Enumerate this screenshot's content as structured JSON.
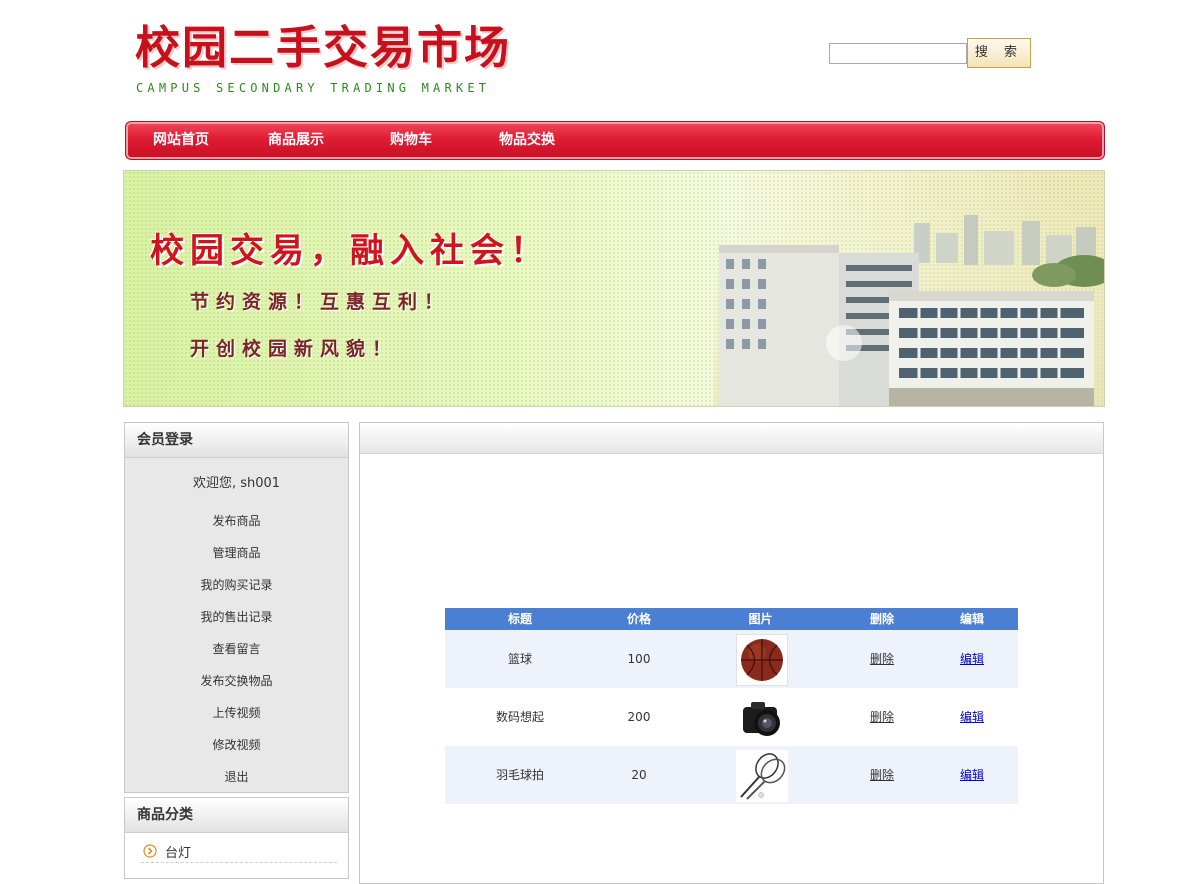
{
  "header": {
    "logo_title": "校园二手交易市场",
    "logo_subtitle": "CAMPUS SECONDARY TRADING MARKET",
    "search_placeholder": "",
    "search_button": "搜 索"
  },
  "nav": {
    "items": [
      {
        "label": "网站首页"
      },
      {
        "label": "商品展示"
      },
      {
        "label": "购物车"
      },
      {
        "label": "物品交换"
      }
    ]
  },
  "banner": {
    "headline": "校园交易，融入社会！",
    "line1": "节约资源！互惠互利！",
    "line2": "开创校园新风貌！"
  },
  "sidebar": {
    "login_title": "会员登录",
    "welcome": "欢迎您, sh001",
    "menu": [
      {
        "label": "发布商品"
      },
      {
        "label": "管理商品"
      },
      {
        "label": "我的购买记录"
      },
      {
        "label": "我的售出记录"
      },
      {
        "label": "查看留言"
      },
      {
        "label": "发布交换物品"
      },
      {
        "label": "上传视频"
      },
      {
        "label": "修改视频"
      },
      {
        "label": "退出"
      }
    ],
    "category_title": "商品分类",
    "categories": [
      {
        "label": "台灯"
      }
    ]
  },
  "table": {
    "headers": [
      "标题",
      "价格",
      "图片",
      "删除",
      "编辑"
    ],
    "rows": [
      {
        "title": "篮球",
        "price": "100",
        "image": "basketball",
        "delete": "删除",
        "edit": "编辑"
      },
      {
        "title": "数码想起",
        "price": "200",
        "image": "camera",
        "delete": "删除",
        "edit": "编辑"
      },
      {
        "title": "羽毛球拍",
        "price": "20",
        "image": "badminton-racket",
        "delete": "删除",
        "edit": "编辑"
      }
    ]
  },
  "colors": {
    "nav_red": "#e01c33",
    "table_header_blue": "#4a7fd4",
    "row_alt": "#eef3fb",
    "edit_link": "#0000cc"
  }
}
